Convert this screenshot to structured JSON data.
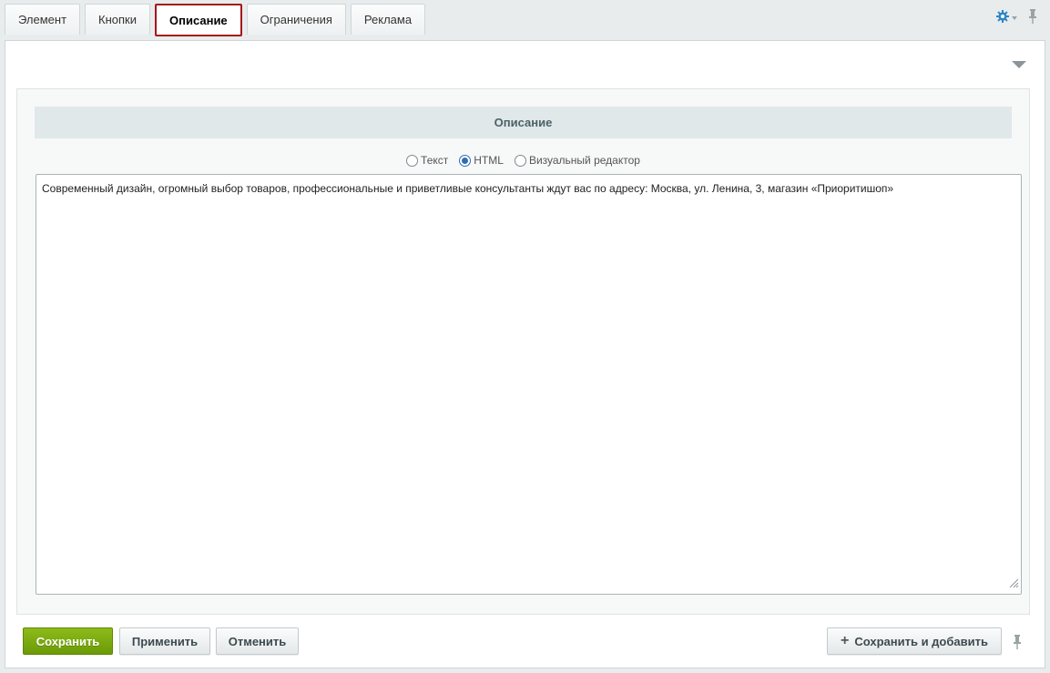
{
  "tabs": [
    {
      "label": "Элемент",
      "active": false
    },
    {
      "label": "Кнопки",
      "active": false
    },
    {
      "label": "Описание",
      "active": true
    },
    {
      "label": "Ограничения",
      "active": false
    },
    {
      "label": "Реклама",
      "active": false
    }
  ],
  "section": {
    "title": "Описание"
  },
  "editor_mode": {
    "options": [
      {
        "label": "Текст",
        "checked": false
      },
      {
        "label": "HTML",
        "checked": true
      },
      {
        "label": "Визуальный редактор",
        "checked": false
      }
    ]
  },
  "description_text": "Современный дизайн, огромный выбор товаров, профессиональные и приветливые консультанты ждут вас по адресу:  Москва, ул. Ленина, 3, магазин «Приоритишоп»",
  "buttons": {
    "save": "Сохранить",
    "apply": "Применить",
    "cancel": "Отменить",
    "save_and_add": "Сохранить и добавить"
  },
  "icons": {
    "settings": "gear-icon",
    "pin": "pin-icon",
    "collapse": "triangle-down-icon",
    "add": "plus-icon"
  },
  "colors": {
    "active_tab_border": "#a5161b",
    "save_button": "#7aa80f",
    "section_header_bg": "#e0e8ea",
    "radio_accent": "#2e6db3"
  }
}
